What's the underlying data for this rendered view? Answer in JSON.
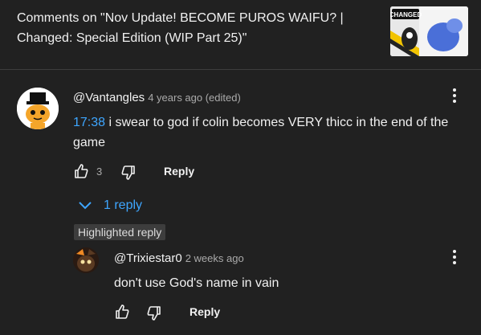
{
  "header": {
    "title": "Comments on \"Nov Update! BECOME PUROS WAIFU? | Changed: Special Edition (WIP Part 25)\"",
    "thumbnail_text": "CHANGED"
  },
  "comment": {
    "author": "@Vantangles",
    "meta": "4 years ago (edited)",
    "timestamp": "17:38",
    "text": " i swear to god if colin becomes VERY thicc in the end of the game",
    "likes": "3",
    "reply_label": "Reply",
    "replies_toggle": "1 reply",
    "more_icon": "kebab-vertical-icon"
  },
  "reply": {
    "badge": "Highlighted reply",
    "author": "@Trixiestar0",
    "meta": "2 weeks ago",
    "text": "don't use God's name in vain",
    "reply_label": "Reply"
  },
  "colors": {
    "background": "#212121",
    "link": "#3ea6ff",
    "muted": "#aaaaaa",
    "badge_bg": "#3d3d3d"
  }
}
